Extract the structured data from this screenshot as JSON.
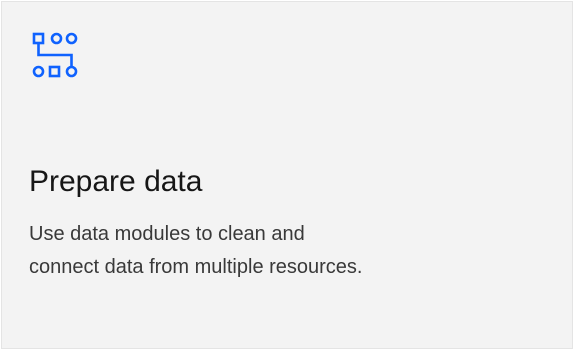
{
  "tile": {
    "icon": "data-flow-icon",
    "accent_color": "#0f62fe",
    "title": "Prepare data",
    "description": "Use data modules to clean and connect data from multiple resources."
  }
}
